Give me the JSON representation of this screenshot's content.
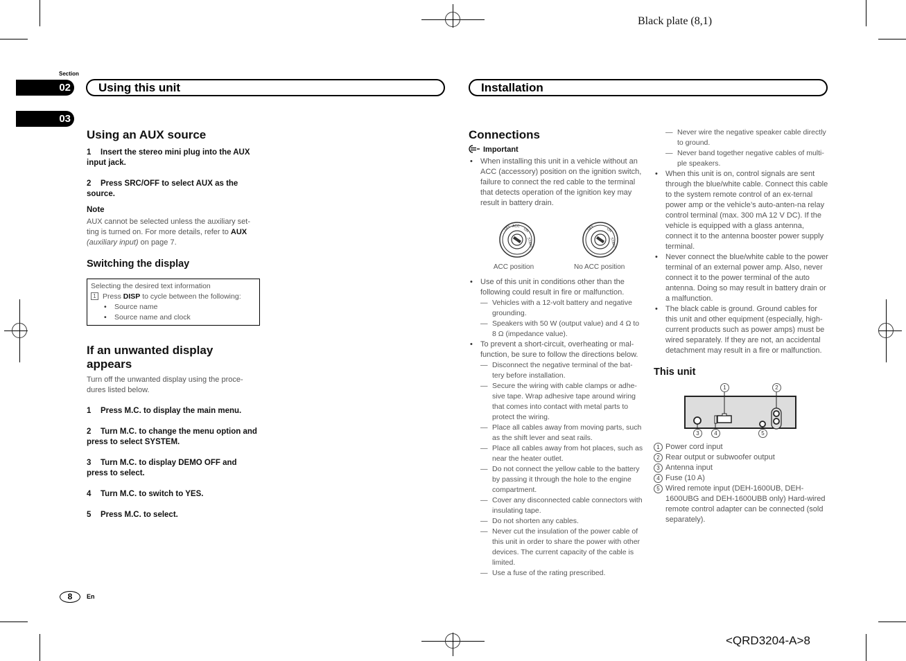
{
  "header": {
    "plate_label": "Black plate (8,1)"
  },
  "footer": {
    "page_number": "8",
    "language": "En",
    "doc_code": "<QRD3204-A>8"
  },
  "section_tabs": {
    "label": "Section",
    "tabs": [
      "02",
      "03"
    ]
  },
  "section_titles": {
    "left": "Using this unit",
    "right": "Installation"
  },
  "left_column": {
    "aux": {
      "title": "Using an AUX source",
      "steps": [
        {
          "num": "1",
          "text": "Insert the stereo mini plug into the AUX input jack."
        },
        {
          "num": "2",
          "text": "Press SRC/OFF to select AUX as the source."
        }
      ],
      "note_title": "Note",
      "note_text_pre": "AUX cannot be selected unless the auxiliary set-ting is turned on. For more details, refer to ",
      "note_bold": "AUX",
      "note_italic": "(auxiliary input)",
      "note_text_post": " on page 7."
    },
    "display": {
      "title": "Switching the display",
      "box_heading": "Selecting the desired text information",
      "box_step_num": "1",
      "box_step_pre": "Press ",
      "box_step_bold": "DISP",
      "box_step_post": " to cycle between the following:",
      "box_items": [
        "Source name",
        "Source name and clock"
      ]
    },
    "unwanted": {
      "title": "If an unwanted display appears",
      "intro": "Turn off the unwanted display using the proce-dures listed below.",
      "steps": [
        {
          "num": "1",
          "text": "Press M.C. to display the main menu."
        },
        {
          "num": "2",
          "text": "Turn M.C. to change the menu option and press to select SYSTEM."
        },
        {
          "num": "3",
          "text": "Turn M.C. to display DEMO OFF and press to select."
        },
        {
          "num": "4",
          "text": "Turn M.C. to switch to YES."
        },
        {
          "num": "5",
          "text": "Press M.C. to select."
        }
      ]
    }
  },
  "connections": {
    "title": "Connections",
    "important_label": "Important",
    "bullet1": "When installing this unit in a vehicle without an ACC (accessory) position on the ignition switch, failure to connect the red cable to the terminal that detects operation of the ignition key may result in battery drain.",
    "figures": [
      {
        "caption": "ACC position",
        "labels": [
          "OFF",
          "ACC",
          "ON",
          "START"
        ]
      },
      {
        "caption": "No ACC position",
        "labels": [
          "OFF",
          "ON",
          "START"
        ]
      }
    ],
    "bullet2": "Use of this unit in conditions other than the following could result in fire or malfunction.",
    "bullet2_sub": [
      "Vehicles with a 12-volt battery and negative grounding.",
      "Speakers with 50 W (output value) and 4 Ω to 8 Ω (impedance value)."
    ],
    "bullet3": "To prevent a short-circuit, overheating or mal-function, be sure to follow the directions below.",
    "bullet3_sub": [
      "Disconnect the negative terminal of the bat-tery before installation.",
      "Secure the wiring with cable clamps or adhe-sive tape. Wrap adhesive tape around wiring that comes into contact with metal parts to protect the wiring.",
      "Place all cables away from moving parts, such as the shift lever and seat rails.",
      "Place all cables away from hot places, such as near the heater outlet.",
      "Do not connect the yellow cable to the battery by passing it through the hole to the engine compartment.",
      "Cover any disconnected cable connectors with insulating tape.",
      "Do not shorten any cables.",
      "Never cut the insulation of the power cable of this unit in order to share the power with other devices. The current capacity of the cable is limited.",
      "Use a fuse of the rating prescribed."
    ]
  },
  "right_column": {
    "sub_continued": [
      "Never wire the negative speaker cable directly to ground.",
      "Never band together negative cables of multi-ple speakers."
    ],
    "bullets": [
      "When this unit is on, control signals are sent through the blue/white cable. Connect this cable to the system remote control of an ex-ternal power amp or the vehicle’s auto-anten-na relay control terminal (max. 300 mA 12 V DC). If the vehicle is equipped with a glass antenna, connect it to the antenna booster power supply terminal.",
      "Never connect the blue/white cable to the power terminal of an external power amp. Also, never connect it to the power terminal of the auto antenna. Doing so may result in battery drain or a malfunction.",
      "The black cable is ground. Ground cables for this unit and other equipment (especially, high-current products such as power amps) must be wired separately. If they are not, an accidental detachment may result in a fire or malfunction."
    ],
    "this_unit": {
      "title": "This unit",
      "callouts": [
        "1",
        "2",
        "3",
        "4",
        "5"
      ],
      "legend": [
        {
          "num": "1",
          "text": "Power cord input"
        },
        {
          "num": "2",
          "text": "Rear output or subwoofer output"
        },
        {
          "num": "3",
          "text": "Antenna input"
        },
        {
          "num": "4",
          "text": "Fuse (10 A)"
        },
        {
          "num": "5",
          "text": "Wired remote input (DEH-1600UB, DEH-1600UBG and DEH-1600UBB only) Hard-wired remote control adapter can be connected (sold separately)."
        }
      ]
    }
  }
}
